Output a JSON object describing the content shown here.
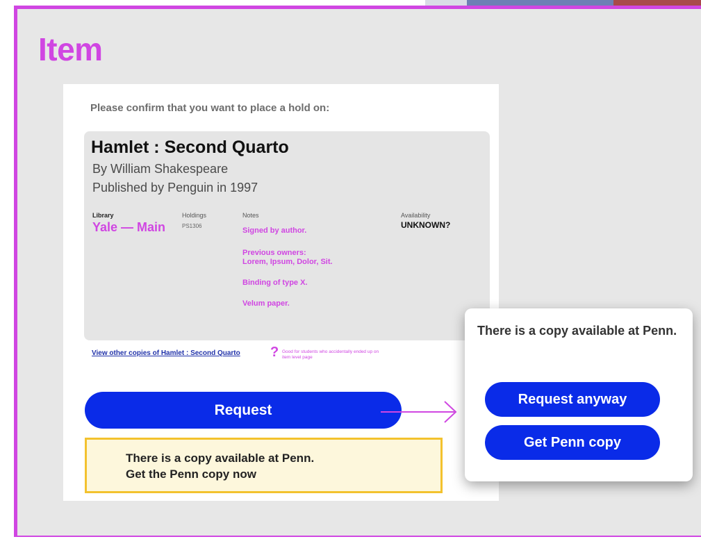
{
  "colors": {
    "accent": "#d046e2",
    "primary_button": "#0a2be8",
    "frame_bg": "#e7e7e7",
    "notice_bg": "#fdf7dc",
    "notice_border": "#f3c22e"
  },
  "page": {
    "title": "Item"
  },
  "hold": {
    "confirm_text": "Please confirm that you want to place a hold on:",
    "book": {
      "title": "Hamlet : Second Quarto",
      "author": "By William Shakespeare",
      "publisher": "Published by Penguin in 1997"
    },
    "columns": {
      "library_label": "Library",
      "holdings_label": "Holdings",
      "notes_label": "Notes",
      "availability_label": "Availability"
    },
    "library": "Yale — Main",
    "holdings": "PS1306",
    "availability": "UNKNOWN?",
    "notes": [
      "Signed by author.",
      "Previous owners:",
      "Lorem, Ipsum, Dolor, Sit.",
      "Binding of type X.",
      "Velum paper."
    ],
    "view_other_link": "View other copies of Hamlet : Second Quarto",
    "help_icon": "question-mark-icon",
    "help_note": "Good for students who accidentally ended up on item level page",
    "request_button": "Request",
    "notice_line1": "There is a copy available at Penn.",
    "notice_line2": "Get the Penn copy now"
  },
  "popup": {
    "message": "There is a copy available at Penn.",
    "request_anyway_button": "Request anyway",
    "get_penn_button": "Get Penn copy"
  }
}
